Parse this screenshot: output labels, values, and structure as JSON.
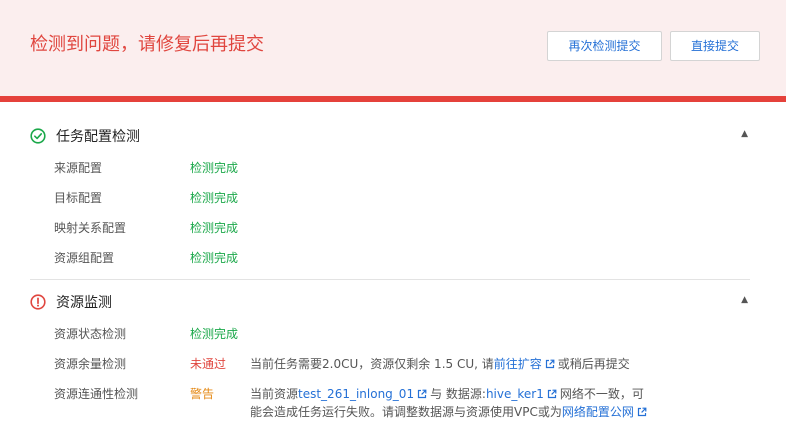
{
  "banner": {
    "title": "检测到问题，请修复后再提交",
    "recheck_label": "再次检测提交",
    "submit_label": "直接提交"
  },
  "sections": {
    "task": {
      "title": "任务配置检测",
      "icon": "check-circle-icon",
      "rows": [
        {
          "label": "来源配置",
          "status": "检测完成"
        },
        {
          "label": "目标配置",
          "status": "检测完成"
        },
        {
          "label": "映射关系配置",
          "status": "检测完成"
        },
        {
          "label": "资源组配置",
          "status": "检测完成"
        }
      ]
    },
    "resource": {
      "title": "资源监测",
      "icon": "warning-circle-icon",
      "rows": [
        {
          "label": "资源状态检测",
          "status": "检测完成"
        },
        {
          "label": "资源余量检测",
          "status": "未通过",
          "msg_before": "当前任务需要2.0CU，资源仅剩余 1.5 CU, 请",
          "msg_link": "前往扩容",
          "msg_after": "或稍后再提交"
        },
        {
          "label": "资源连通性检测",
          "status": "警告",
          "msg_part1": "当前资源",
          "msg_link1": "test_261_inlong_01",
          "msg_part2": "与 数据源:",
          "msg_link2": "hive_ker1",
          "msg_part3": "网络不一致，可能会造成任务运行失败。请调整数据源与资源使用VPC或为",
          "msg_link3": "网络配置公网"
        }
      ]
    }
  },
  "colors": {
    "ok": "#1ba84a",
    "fail": "#e0463f",
    "warn": "#e58a16",
    "link": "#2470d6",
    "banner_bg": "#fbeeee",
    "banner_bar": "#e5413b"
  }
}
